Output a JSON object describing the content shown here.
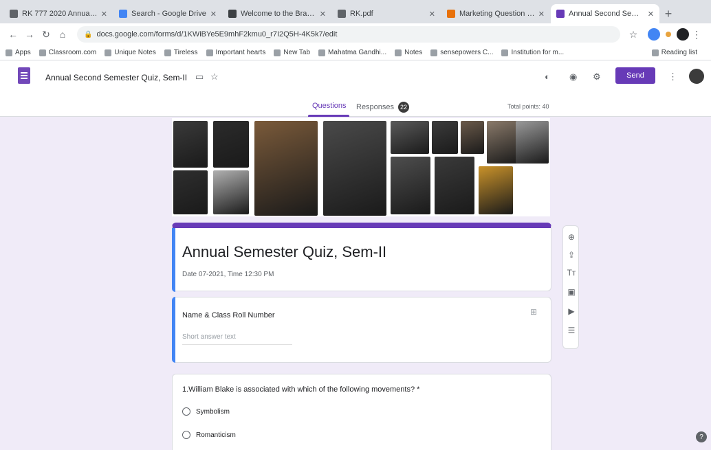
{
  "browser": {
    "tabs": [
      {
        "title": "RK 777 2020 Annual Result...",
        "color": "#5f6368"
      },
      {
        "title": "Search - Google Drive",
        "color": "#4285f4"
      },
      {
        "title": "Welcome to the Brave...",
        "color": "#3c4043"
      },
      {
        "title": "RK.pdf",
        "color": "#5f6368"
      },
      {
        "title": "Marketing Question Bank",
        "color": "#e8710a"
      },
      {
        "title": "Annual Second Semester",
        "color": "#673ab7"
      }
    ],
    "url": "docs.google.com/forms/d/1KWiBYe5E9mhF2kmu0_r7I2Q5H-4K5k7/edit",
    "bookmarks": [
      "Apps",
      "Classroom.com",
      "Unique Notes",
      "Tireless",
      "Important hearts",
      "New Tab",
      "Mahatma Gandhi...",
      "Notes",
      "sensepowers C...",
      "Institution for m..."
    ],
    "reading_list": "Reading list"
  },
  "forms": {
    "doc_title": "Annual Second Semester Quiz, Sem-II",
    "send_label": "Send",
    "tabs": {
      "questions": "Questions",
      "responses": "Responses",
      "responses_count": "22"
    },
    "total_points": "Total points: 40"
  },
  "form": {
    "title": "Annual Semester Quiz, Sem-II",
    "description": "Date 07-2021, Time 12:30 PM",
    "question1": {
      "title": "Name & Class Roll Number",
      "placeholder": "Short answer text"
    },
    "question2": {
      "title": "1.William Blake is associated with which of the following movements? *",
      "options": [
        "Symbolism",
        "Romanticism"
      ]
    }
  },
  "photos": [
    {
      "color": "#3a3a3a"
    },
    {
      "color": "#2b2b2b"
    },
    {
      "color": "#7a5a3a"
    },
    {
      "color": "#4a4a4a"
    },
    {
      "color": "#5a5a5a"
    },
    {
      "color": "#3c3c3c"
    },
    {
      "color": "#6b5a4a"
    },
    {
      "color": "#8a7a6a"
    },
    {
      "color": "#9a9a9a"
    },
    {
      "color": "#2e2e2e"
    },
    {
      "color": "#b0b0b0"
    },
    {
      "color": "#4e4e4e"
    },
    {
      "color": "#3a3a3a"
    },
    {
      "color": "#c9922a"
    }
  ],
  "accent": "#673ab7"
}
